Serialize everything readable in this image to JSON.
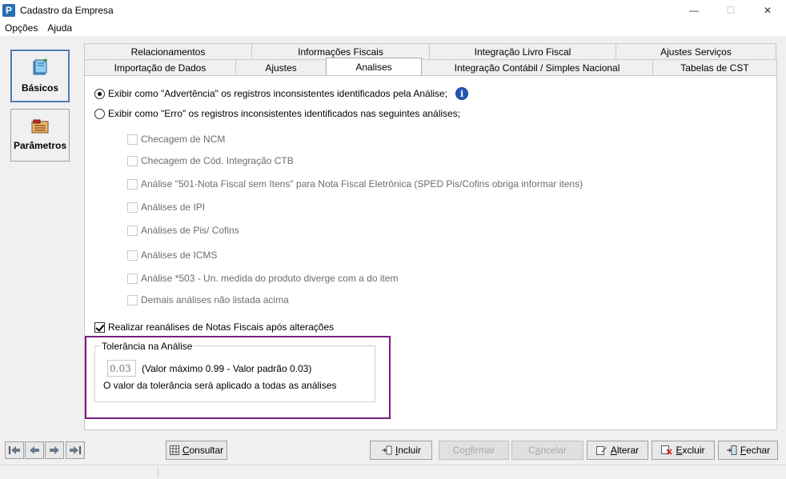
{
  "window": {
    "title": "Cadastro da Empresa",
    "icon_letter": "P",
    "controls": {
      "minimize": "—",
      "maximize": "☐",
      "close": "✕"
    }
  },
  "menu": [
    "Opções",
    "Ajuda"
  ],
  "sidebar": {
    "items": [
      {
        "label": "Básicos",
        "icon": "book-icon",
        "active": true
      },
      {
        "label": "Parâmetros",
        "icon": "folder-icon",
        "active": false
      }
    ]
  },
  "tabs": {
    "row1": [
      "Relacionamentos",
      "Informações Fiscais",
      "Integração Livro Fiscal",
      "Ajustes Serviços"
    ],
    "row2": [
      "Importação de Dados",
      "Ajustes",
      "Analises",
      "Integração Contábil / Simples Nacional",
      "Tabelas de CST"
    ],
    "active": "Analises"
  },
  "analises": {
    "radio_warning": "Exibir como \"Advertência\" os registros inconsistentes identificados pela Análise;",
    "radio_error": "Exibir como \"Erro\" os registros inconsistentes identificados nas seguintes análises;",
    "info_glyph": "i",
    "checks": [
      "Checagem de NCM",
      "Checagem de Cód. Integração CTB",
      "Análise \"501-Nota Fiscal sem Itens\" para Nota Fiscal Eletrônica (SPED Pis/Cofins obriga informar itens)",
      "Análises de IPI",
      "Análises de Pis/ Cofins",
      "Análises de ICMS",
      "Análise *503 - Un. medida do produto diverge com a do item",
      "Demais análises não listada acima"
    ],
    "reanalise_label": "Realizar reanálises de Notas Fiscais após alterações",
    "reanalise_checked": true,
    "tolerance": {
      "title": "Tolerância na Análise",
      "value": "0.03",
      "desc": "(Valor máximo 0.99 - Valor padrão 0.03)",
      "note": "O valor da tolerância será aplicado a todas as análises"
    }
  },
  "buttons": {
    "consultar": {
      "pre": "",
      "u": "C",
      "post": "onsultar"
    },
    "incluir": {
      "pre": "",
      "u": "I",
      "post": "ncluir"
    },
    "confirmar": {
      "pre": "Co",
      "u": "n",
      "post": "firmar"
    },
    "cancelar": {
      "pre": "C",
      "u": "a",
      "post": "ncelar"
    },
    "alterar": {
      "pre": "",
      "u": "A",
      "post": "lterar"
    },
    "excluir": {
      "pre": "",
      "u": "E",
      "post": "xcluir"
    },
    "fechar": {
      "pre": "",
      "u": "F",
      "post": "echar"
    }
  },
  "colors": {
    "highlight": "#7b1f7f",
    "info": "#2557b8",
    "disabled_text": "#a8a8a8"
  }
}
